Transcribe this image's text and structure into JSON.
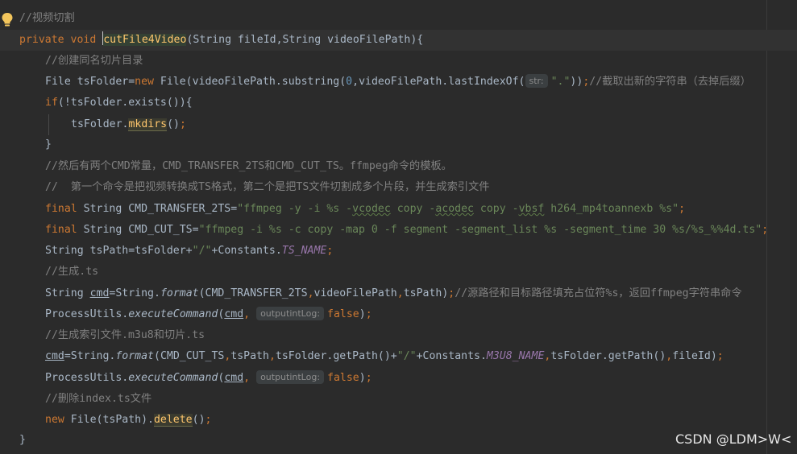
{
  "editor": {
    "param_hints": {
      "str": "str:",
      "output": "outputintLog:"
    },
    "lines": {
      "l1": "//视频切割",
      "l2": {
        "kw1": "private void ",
        "name": "cutFile4Video",
        "rest": "(String fileId,String videoFilePath){"
      },
      "l3": "//创建同名切片目录",
      "l4": {
        "a": "File tsFolder=",
        "kw": "new ",
        "b": "File(videoFilePath.substring(",
        "n0": "0",
        "c": ",videoFilePath.lastIndexOf(",
        "s": "\".\"",
        "d": "))",
        "semi": ";",
        "comment": "//截取出新的字符串（去掉后缀）"
      },
      "l5": {
        "kw": "if",
        "rest": "(!tsFolder.exists()){"
      },
      "l6": {
        "a": "tsFolder.",
        "m": "mkdirs",
        "b": "()",
        "semi": ";"
      },
      "l7": "}",
      "l8": "//然后有两个CMD常量，CMD_TRANSFER_2TS和CMD_CUT_TS。ffmpeg命令的模板。",
      "l9": "//  第一个命令是把视频转换成TS格式，第二个是把TS文件切割成多个片段，并生成索引文件",
      "l10": {
        "kw": "final ",
        "a": "String CMD_TRANSFER_2TS=",
        "s1": "\"ffmpeg -y -i %s -",
        "w1": "vcodec",
        "s2": " copy -",
        "w2": "acodec",
        "s3": " copy -",
        "w3": "vbsf",
        "s4": " h264_mp4toannexb %s\"",
        "semi": ";"
      },
      "l11": {
        "kw": "final ",
        "a": "String CMD_CUT_TS=",
        "s": "\"ffmpeg -i %s -c copy -map 0 -f segment -segment_list %s -segment_time 30 %s/%s_%%4d.ts\"",
        "semi": ";"
      },
      "l12": {
        "a": "String tsPath=tsFolder+",
        "s": "\"/\"",
        "b": "+Constants.",
        "st": "TS_NAME",
        "semi": ";"
      },
      "l13": "//生成.ts",
      "l14": {
        "a": "String ",
        "v": "cmd",
        "b": "=String.",
        "f": "format",
        "c": "(CMD_TRANSFER_2TS",
        "comma1": ",",
        "d": "videoFilePath",
        "comma2": ",",
        "e": "tsPath)",
        "semi": ";",
        "comment": "//源路径和目标路径填充占位符%s，返回ffmpeg字符串命令"
      },
      "l15": {
        "a": "ProcessUtils.",
        "f": "executeCommand",
        "b": "(",
        "v": "cmd",
        "comma": ",",
        "kw": "false",
        "c": ")",
        "semi": ";"
      },
      "l16": "//生成索引文件.m3u8和切片.ts",
      "l17": {
        "v": "cmd",
        "a": "=String.",
        "f": "format",
        "b": "(CMD_CUT_TS",
        "comma1": ",",
        "c": "tsPath",
        "comma2": ",",
        "d": "tsFolder.getPath()+",
        "s": "\"/\"",
        "e": "+Constants.",
        "st": "M3U8_NAME",
        "comma3": ",",
        "g": "tsFolder.getPath()",
        "comma4": ",",
        "h": "fileId)",
        "semi": ";"
      },
      "l18": {
        "a": "ProcessUtils.",
        "f": "executeCommand",
        "b": "(",
        "v": "cmd",
        "comma": ",",
        "kw": "false",
        "c": ")",
        "semi": ";"
      },
      "l19": "//删除index.ts文件",
      "l20": {
        "kw": "new ",
        "a": "File(tsPath).",
        "m": "delete",
        "b": "()",
        "semi": ";"
      },
      "l21": "}"
    }
  },
  "watermark": "CSDN @LDM>W<",
  "colors": {
    "background": "#2b2b2b",
    "keyword": "#cc7832",
    "string": "#6a8759",
    "comment": "#808080",
    "method": "#ffc66d",
    "static": "#9876aa",
    "number": "#6897bb"
  }
}
